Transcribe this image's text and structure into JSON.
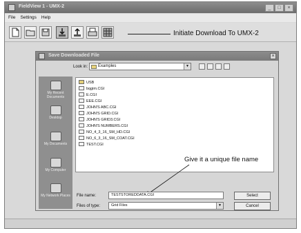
{
  "app": {
    "title": "FieldView 1 - UMX-2",
    "window_controls": [
      "_",
      "□",
      "×"
    ]
  },
  "menu": [
    "File",
    "Settings",
    "Help"
  ],
  "toolbar": {
    "icons": [
      "new-doc-icon",
      "open-icon",
      "save-icon",
      "download-icon",
      "upload-icon",
      "print-icon",
      "grid-icon"
    ],
    "callout": "Initiate Download To UMX-2"
  },
  "dialog": {
    "title": "Save Downloaded File",
    "look_in_label": "Look in:",
    "look_in_value": "Examples",
    "places": [
      "My Recent Documents",
      "Desktop",
      "My Documents",
      "My Computer",
      "My Network Places"
    ],
    "files": [
      {
        "name": "USB",
        "type": "folder"
      },
      {
        "name": "bqgim.CGI",
        "type": "file"
      },
      {
        "name": "E.CGI",
        "type": "file"
      },
      {
        "name": "EEE.CGI",
        "type": "file"
      },
      {
        "name": "JOHN'S ABC.CGI",
        "type": "file"
      },
      {
        "name": "JOHN'S GRID.CGI",
        "type": "file"
      },
      {
        "name": "JOHN'S GRID3.CGI",
        "type": "file"
      },
      {
        "name": "JOHN'S NUMBERS.CGI",
        "type": "file"
      },
      {
        "name": "NO_4_3_16_SM_HD.CGI",
        "type": "file"
      },
      {
        "name": "NO_6_3_16_SM_COAT.CGI",
        "type": "file"
      },
      {
        "name": "TEST.CGI",
        "type": "file"
      }
    ],
    "annotation": "Give it a unique file name",
    "file_name_label": "File name:",
    "file_name_value": "TESTSTOREDDATA.CGI",
    "file_type_label": "Files of type:",
    "file_type_value": "Grid Files",
    "select_label": "Select",
    "cancel_label": "Cancel"
  }
}
